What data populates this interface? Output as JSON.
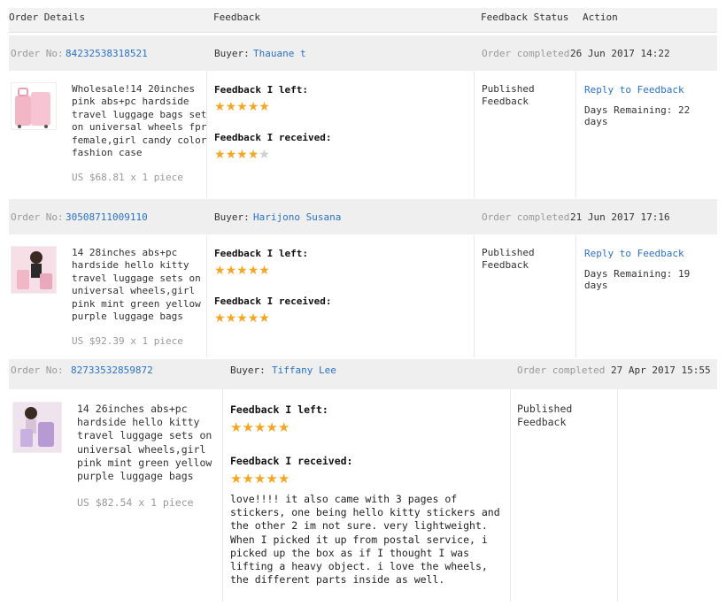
{
  "header": {
    "order_details": "Order Details",
    "feedback": "Feedback",
    "feedback_status": "Feedback Status",
    "action": "Action"
  },
  "orders": [
    {
      "order_no_label": "Order No:",
      "order_no": "84232538318521",
      "buyer_label": "Buyer:",
      "buyer": "Thauane t",
      "completed_label": "Order completed",
      "completed_date": "26 Jun 2017 14:22",
      "title": [
        "Wholesale!14 20inches",
        "pink abs+pc hardside",
        "travel luggage bags set",
        "on universal wheels fpr",
        "female,girl candy color",
        "fashion case"
      ],
      "price": "US $68.81 x 1 piece",
      "feedback_left_label": "Feedback I left:",
      "feedback_left_rating": 5,
      "feedback_received_label": "Feedback I received:",
      "feedback_received_rating": 4,
      "status": [
        "Published",
        "Feedback"
      ],
      "reply_link": "Reply to Feedback",
      "days_remaining": "Days Remaining: 22 days"
    },
    {
      "order_no_label": "Order No:",
      "order_no": "30508711009110",
      "buyer_label": "Buyer:",
      "buyer": "Harijono Susana",
      "completed_label": "Order completed",
      "completed_date": "21 Jun 2017 17:16",
      "title": [
        "14 28inches abs+pc",
        "hardside hello kitty",
        "travel luggage sets on",
        "universal wheels,girl",
        "pink mint green yellow",
        "purple luggage bags"
      ],
      "price": "US $92.39 x 1 piece",
      "feedback_left_label": "Feedback I left:",
      "feedback_left_rating": 5,
      "feedback_received_label": "Feedback I received:",
      "feedback_received_rating": 5,
      "status": [
        "Published",
        "Feedback"
      ],
      "reply_link": "Reply to Feedback",
      "days_remaining": "Days Remaining: 19 days"
    },
    {
      "order_no_label": "Order No:",
      "order_no": "82733532859872",
      "buyer_label": "Buyer:",
      "buyer": "Tiffany Lee",
      "completed_label": "Order completed",
      "completed_date": "27 Apr 2017 15:55",
      "title": [
        "14 26inches abs+pc",
        "hardside hello kitty",
        "travel luggage sets on",
        "universal wheels,girl",
        "pink mint green yellow",
        "purple luggage bags"
      ],
      "price": "US $82.54 x 1 piece",
      "feedback_left_label": "Feedback I left:",
      "feedback_left_rating": 5,
      "feedback_received_label": "Feedback I received:",
      "feedback_received_rating": 5,
      "comment": [
        "love!!!! it also came with 3 pages of",
        "stickers, one being hello kitty stickers and",
        "the other 2 im not sure. very lightweight.",
        "When I picked it up from postal service, i",
        "picked up the box as if I thought I was",
        "lifting a heavy object. i love the wheels,",
        "the different parts inside as well."
      ],
      "status": [
        "Published",
        "Feedback"
      ]
    }
  ],
  "colors": {
    "link": "#2a72c8",
    "star": "#f5a623",
    "star_empty": "#cfcfcf",
    "bar_bg": "#efefef"
  }
}
